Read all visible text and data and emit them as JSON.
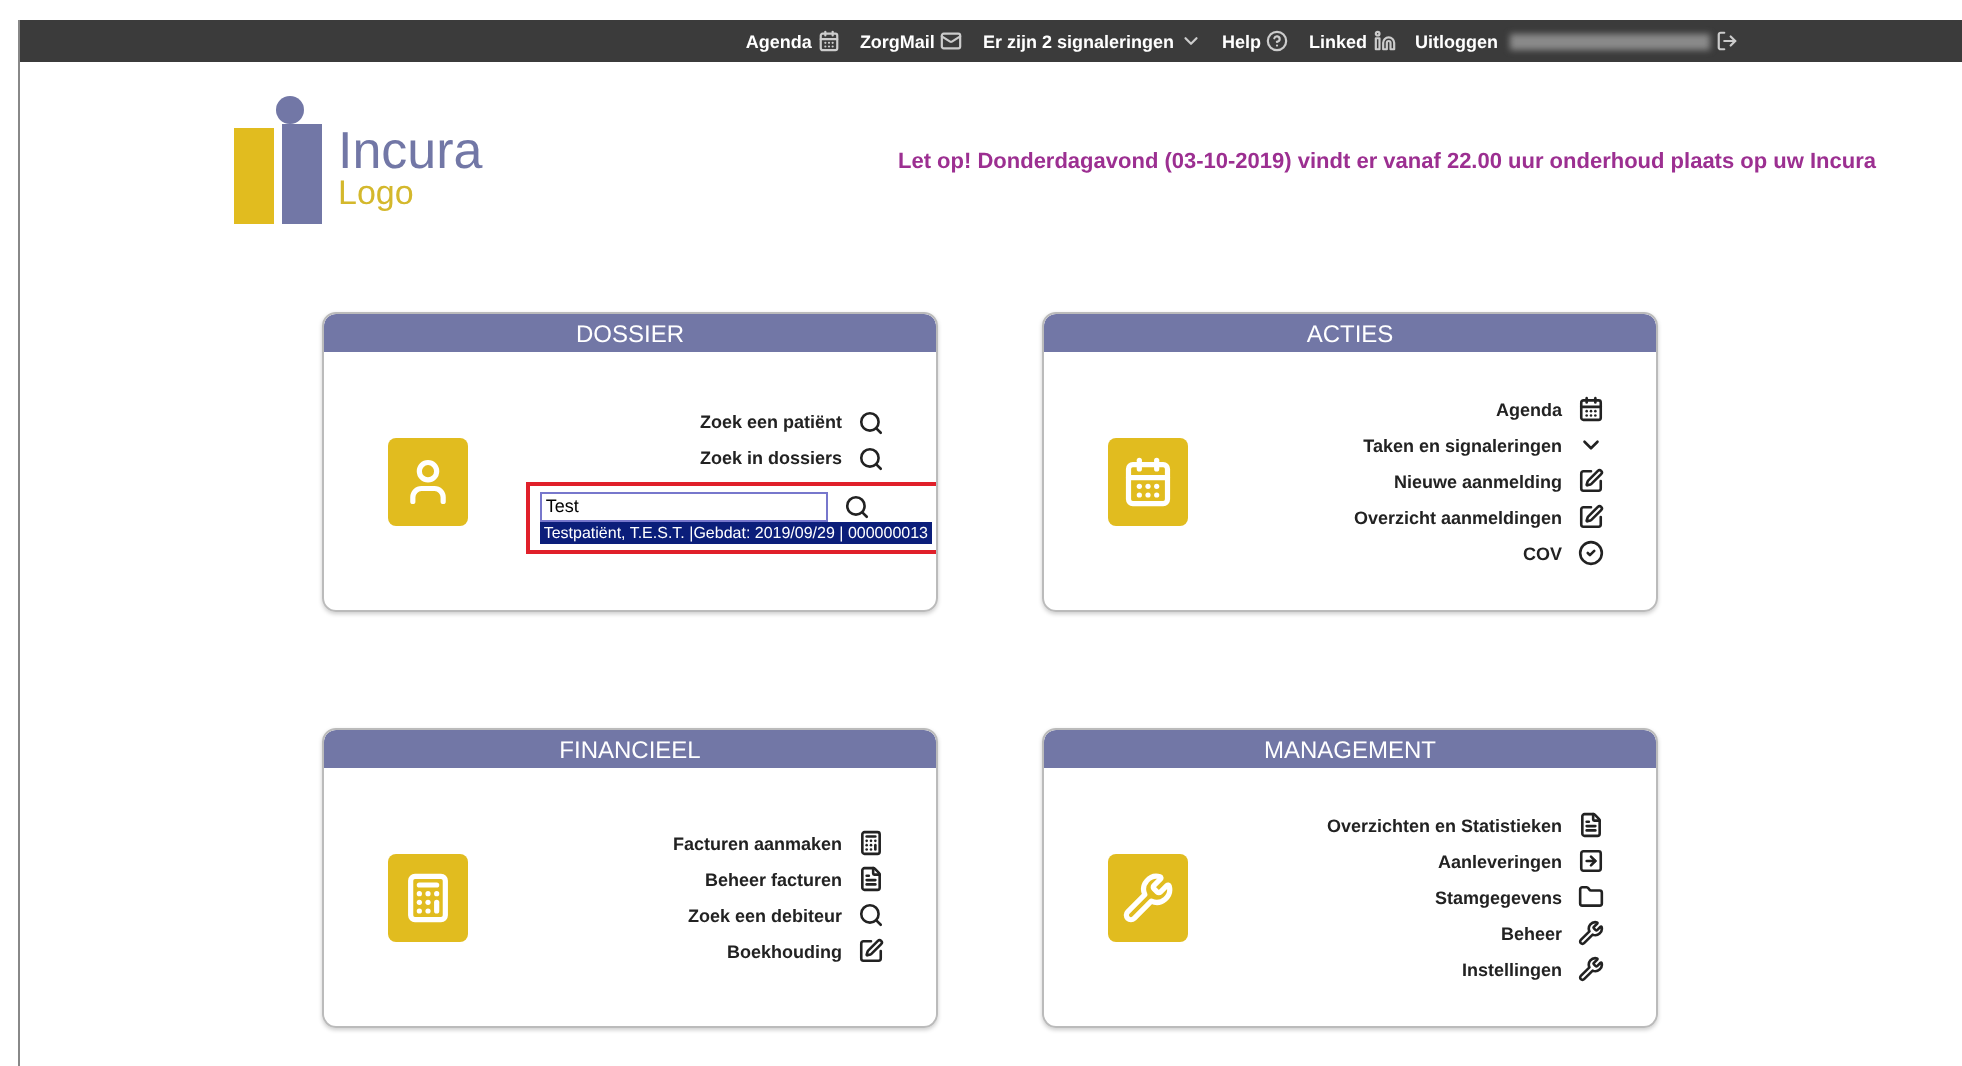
{
  "top_bar": {
    "links": [
      {
        "label": "Agenda",
        "kind": "calendar"
      },
      {
        "label": "ZorgMail",
        "kind": "mail"
      },
      {
        "label": "Er zijn 2 signaleringen",
        "kind": "caret"
      },
      {
        "label": "Help",
        "kind": "help"
      },
      {
        "label": "Linked",
        "kind": "linkedin"
      },
      {
        "label": "Uitloggen",
        "kind": "logout"
      }
    ]
  },
  "logo": {
    "name": "Incura",
    "sub": "Logo"
  },
  "notice": "Let op! Donderdagavond (03-10-2019) vindt er vanaf 22.00 uur onderhoud plaats op uw Incura",
  "cards": [
    {
      "title": "DOSSIER",
      "kind": "person",
      "items": [
        {
          "label": "Zoek een patiënt",
          "kind": "search"
        },
        {
          "label": "Zoek in dossiers",
          "kind": "search"
        }
      ],
      "search": {
        "value": "Test",
        "suggestions": [
          {
            "label": "Testpatiënt, T.E.S.T. |Gebdat: 2019/09/29 | 000000013",
            "selected": true
          }
        ]
      }
    },
    {
      "title": "ACTIES",
      "kind": "calendar",
      "items": [
        {
          "label": "Agenda",
          "kind": "calendar"
        },
        {
          "label": "Taken en signaleringen",
          "kind": "caret"
        },
        {
          "label": "Nieuwe aanmelding",
          "kind": "edit"
        },
        {
          "label": "Overzicht aanmeldingen",
          "kind": "edit"
        },
        {
          "label": "COV",
          "kind": "check"
        }
      ]
    },
    {
      "title": "FINANCIEEL",
      "kind": "calculator",
      "items": [
        {
          "label": "Facturen aanmaken",
          "kind": "calculator"
        },
        {
          "label": "Beheer facturen",
          "kind": "document"
        },
        {
          "label": "Zoek een debiteur",
          "kind": "search"
        },
        {
          "label": "Boekhouding",
          "kind": "edit"
        }
      ]
    },
    {
      "title": "MANAGEMENT",
      "kind": "wrench",
      "items": [
        {
          "label": "Overzichten en Statistieken",
          "kind": "document"
        },
        {
          "label": "Aanleveringen",
          "kind": "arrow"
        },
        {
          "label": "Stamgegevens",
          "kind": "folder"
        },
        {
          "label": "Beheer",
          "kind": "tools"
        },
        {
          "label": "Instellingen",
          "kind": "tools"
        }
      ]
    }
  ]
}
